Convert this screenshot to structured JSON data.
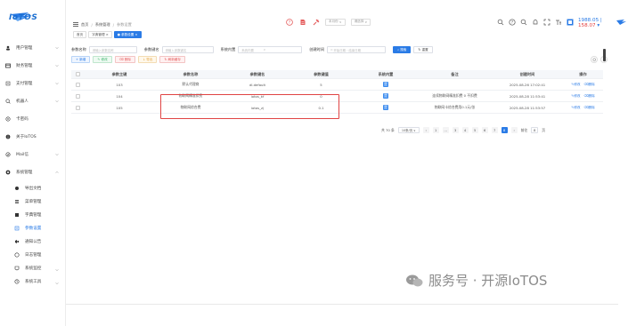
{
  "app": {
    "logo_text": "IoTOS"
  },
  "sidebar": {
    "items": [
      {
        "label": "用户管理",
        "icon": "user-icon"
      },
      {
        "label": "财务管理",
        "icon": "finance-icon"
      },
      {
        "label": "支付管理",
        "icon": "pay-icon"
      },
      {
        "label": "机器人",
        "icon": "robot-icon"
      },
      {
        "label": "卡密码",
        "icon": "key-icon"
      },
      {
        "label": "关于IoTOS",
        "icon": "info-icon"
      },
      {
        "label": "Mail信",
        "icon": "mail-icon"
      },
      {
        "label": "系统管理",
        "icon": "gear-icon"
      }
    ],
    "sub_items": [
      {
        "label": "导出文档",
        "icon": "export-icon"
      },
      {
        "label": "菜单管理",
        "icon": "menu-icon"
      },
      {
        "label": "字典管理",
        "icon": "dict-icon"
      },
      {
        "label": "参数设置",
        "icon": "param-icon",
        "active": true
      },
      {
        "label": "通知公告",
        "icon": "notice-icon"
      },
      {
        "label": "日志管理",
        "icon": "log-icon"
      },
      {
        "label": "系统监控",
        "icon": "monitor-icon"
      },
      {
        "label": "系统工具",
        "icon": "tool-icon"
      }
    ]
  },
  "breadcrumb": {
    "home": "首页",
    "parent": "系统管理",
    "current": "参数设置"
  },
  "topbar": {
    "select1": "本月份",
    "select2": "请选择",
    "stats_prefix": "1988.05",
    "stats_value": "158.07"
  },
  "tabs": [
    {
      "label": "首页",
      "active": false
    },
    {
      "label": "字典管理",
      "active": false
    },
    {
      "label": "参数设置",
      "active": true
    }
  ],
  "filters": {
    "name_label": "参数名称",
    "name_placeholder": "请输入参数名称",
    "key_label": "参数键名",
    "key_placeholder": "请输入参数键名",
    "sys_label": "系统内置",
    "sys_placeholder": "系统内置",
    "time_label": "创建时间",
    "time_start": "开始日期",
    "time_end": "结束日期",
    "search_btn": "搜索",
    "reset_btn": "重置"
  },
  "actions": {
    "add": "新增",
    "edit": "修改",
    "delete": "删除",
    "export": "导出",
    "refresh": "刷新缓存"
  },
  "table": {
    "headers": [
      "参数主键",
      "参数名称",
      "参数键名",
      "参数键值",
      "系统内置",
      "备注",
      "创建时间",
      "操作"
    ],
    "rows": [
      {
        "id": "103",
        "name": "默认代理商",
        "key": "dl.default",
        "value": "5",
        "sys": "是",
        "remark": "",
        "time": "2025-08-26 17:02:41",
        "op1": "修改",
        "op2": "删除"
      },
      {
        "id": "104",
        "name": "物联网精准扣费",
        "key": "iotos_kf",
        "value": "0",
        "sys": "是",
        "remark": "连续物联网精准扣费 0 不扣费",
        "time": "2025-08-28 11:53:41",
        "op1": "修改",
        "op2": "删除"
      },
      {
        "id": "105",
        "name": "物联网综合费",
        "key": "iotos_zj",
        "value": "0.1",
        "sys": "是",
        "remark": "物联网卡综合费用0.1元/张",
        "time": "2025-08-28 11:53:57",
        "op1": "修改",
        "op2": "删除"
      }
    ]
  },
  "pager": {
    "total": "共 70 条",
    "page_size": "10条/页",
    "pages": [
      "1",
      "2",
      "3",
      "4",
      "5",
      "6",
      "7",
      "8"
    ],
    "active_page": "8",
    "goto_label": "前往",
    "goto_value": "8",
    "goto_unit": "页"
  },
  "watermark": {
    "text": "服务号 · 开源IoTOS"
  },
  "colors": {
    "accent": "#2a7be6",
    "danger": "#e04444"
  }
}
